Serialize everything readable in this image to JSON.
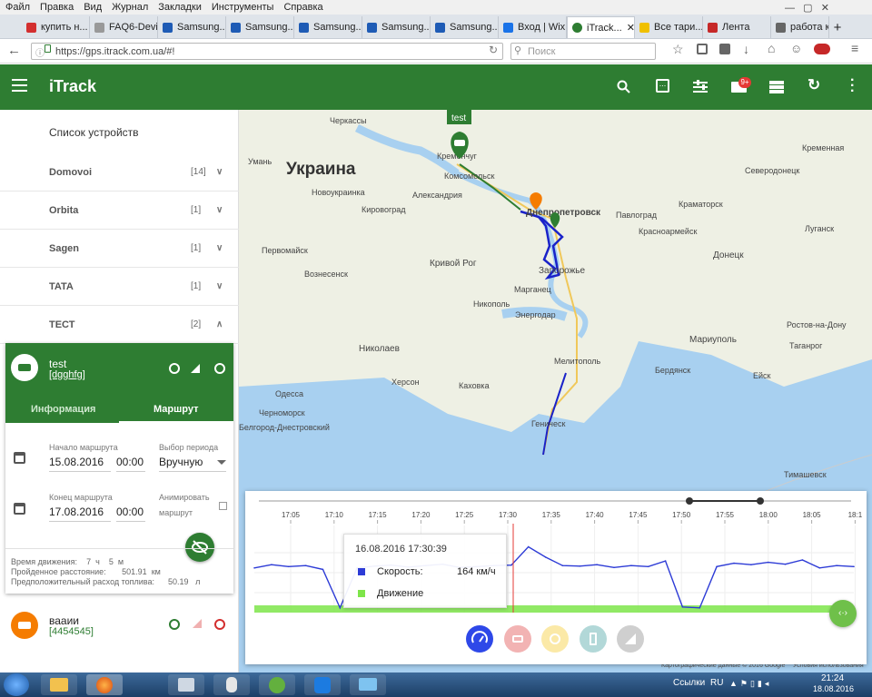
{
  "browser": {
    "menu": [
      "Файл",
      "Правка",
      "Вид",
      "Журнал",
      "Закладки",
      "Инструменты",
      "Справка"
    ],
    "tabs": [
      {
        "label": "купить н...",
        "color": "#d32f2f"
      },
      {
        "label": "FAQ6-Device...",
        "color": "#888"
      },
      {
        "label": "Samsung...",
        "color": "#1e5bb5"
      },
      {
        "label": "Samsung...",
        "color": "#1e5bb5"
      },
      {
        "label": "Samsung...",
        "color": "#1e5bb5"
      },
      {
        "label": "Samsung...",
        "color": "#1e5bb5"
      },
      {
        "label": "Samsung...",
        "color": "#1e5bb5"
      },
      {
        "label": "Вход | Wix",
        "color": "#1a73e8"
      },
      {
        "label": "iTrack...",
        "color": "#2e7d32"
      },
      {
        "label": "Все тари...",
        "color": "#f0c000"
      },
      {
        "label": "Лента",
        "color": "#c62828"
      },
      {
        "label": "работа к...",
        "color": "#555"
      }
    ],
    "url": "https://gps.itrack.com.ua/#!",
    "url_domain": "itrack.com.ua",
    "search_placeholder": "Поиск"
  },
  "app": {
    "title": "iTrack",
    "mail_badge": "9+",
    "accent": "#2e7d32"
  },
  "sidebar": {
    "header": "Список устройств",
    "groups": [
      {
        "name": "Domovoi",
        "count": "[14]"
      },
      {
        "name": "Orbita",
        "count": "[1]"
      },
      {
        "name": "Sagen",
        "count": "[1]"
      },
      {
        "name": "TATA",
        "count": "[1]"
      },
      {
        "name": "ТЕСТ",
        "count": "[2]"
      }
    ],
    "device": {
      "name": "test",
      "id": "[dgghfg]",
      "tab_info": "Информация",
      "tab_route": "Маршрут",
      "route_start_label": "Начало маршрута",
      "route_start_date": "15.08.2016",
      "route_start_time": "00:00",
      "period_label": "Выбор периода",
      "period_value": "Вручную",
      "route_end_label": "Конец маршрута",
      "route_end_date": "17.08.2016",
      "route_end_time": "00:00",
      "animate_label_1": "Анимировать",
      "animate_label_2": "маршрут",
      "stat_time_label": "Время движения:",
      "stat_time_h": "7",
      "stat_time_h_unit": "ч",
      "stat_time_m": "5",
      "stat_time_m_unit": "м",
      "stat_dist_label": "Пройденное расстояние:",
      "stat_dist_value": "501.91",
      "stat_dist_unit": "км",
      "stat_fuel_label": "Предположительный расход топлива:",
      "stat_fuel_value": "50.19",
      "stat_fuel_unit": "л"
    },
    "device2": {
      "name": "вааии",
      "id": "[4454545]"
    }
  },
  "map": {
    "country": "Украина",
    "marker_label": "test",
    "cities": [
      {
        "name": "Черкассы"
      },
      {
        "name": "Кременчуг"
      },
      {
        "name": "Комсомольск"
      },
      {
        "name": "Александрия"
      },
      {
        "name": "Днепропетровск"
      },
      {
        "name": "Кировоград"
      },
      {
        "name": "Кривой Рог"
      },
      {
        "name": "Запорожье"
      },
      {
        "name": "Никополь"
      },
      {
        "name": "Марганец"
      },
      {
        "name": "Энергодар"
      },
      {
        "name": "Николаев"
      },
      {
        "name": "Херсон"
      },
      {
        "name": "Мелитополь"
      },
      {
        "name": "Одесса"
      },
      {
        "name": "Черноморск"
      },
      {
        "name": "Белгород-Днестровский"
      },
      {
        "name": "Геническ"
      },
      {
        "name": "Павлоград"
      },
      {
        "name": "Краматорск"
      },
      {
        "name": "Донецк"
      },
      {
        "name": "Северодонецк"
      },
      {
        "name": "Луганск"
      },
      {
        "name": "Мариуполь"
      },
      {
        "name": "Бердянск"
      },
      {
        "name": "Ейск"
      },
      {
        "name": "Ростов-на-Дону"
      },
      {
        "name": "Таганрог"
      },
      {
        "name": "Тимашевск"
      },
      {
        "name": "Умань"
      },
      {
        "name": "Первомайск"
      },
      {
        "name": "Вознесенск"
      },
      {
        "name": "Новоукраинка"
      },
      {
        "name": "Каховка"
      },
      {
        "name": "Красноармейск"
      },
      {
        "name": "Кременная"
      }
    ],
    "attribution": "Картографические данные © 2016 Google",
    "terms": "Условия использования"
  },
  "chart_data": {
    "type": "line",
    "timeline_ticks": [
      "17:05",
      "17:10",
      "17:15",
      "17:20",
      "17:25",
      "17:30",
      "17:35",
      "17:40",
      "17:45",
      "17:50",
      "17:55",
      "18:00",
      "18:05",
      "18:1"
    ],
    "x_minutes": [
      0,
      2,
      4,
      6,
      8,
      10,
      12,
      14,
      16,
      18,
      20,
      22,
      24,
      26,
      28,
      30,
      32,
      34,
      36,
      38,
      40,
      42,
      44,
      46,
      48,
      50,
      52,
      54,
      56,
      58,
      60,
      62,
      64,
      66,
      68,
      70
    ],
    "series": [
      {
        "name": "Скорость",
        "color": "#2d3bd6",
        "values": [
          95,
          102,
          98,
          100,
          92,
          10,
          95,
          99,
          101,
          97,
          100,
          103,
          96,
          98,
          100,
          101,
          140,
          118,
          100,
          99,
          102,
          96,
          100,
          98,
          110,
          12,
          10,
          98,
          105,
          102,
          107,
          103,
          112,
          95,
          100,
          98
        ]
      },
      {
        "name": "Движение",
        "color": "#7ee54a",
        "values": [
          1,
          1,
          1,
          1,
          1,
          1,
          1,
          1,
          1,
          1,
          1,
          1,
          1,
          1,
          1,
          1,
          1,
          1,
          1,
          1,
          1,
          1,
          1,
          1,
          1,
          1,
          1,
          1,
          1,
          1,
          1,
          1,
          1,
          1,
          1,
          1
        ]
      }
    ],
    "tooltip": {
      "title": "16.08.2016 17:30:39",
      "speed_label": "Скорость:",
      "speed_value": "164 км/ч",
      "move_label": "Движение"
    },
    "ylim": [
      0,
      170
    ]
  },
  "taskbar": {
    "links": "Ссылки",
    "lang": "RU",
    "time": "21:24",
    "date": "18.08.2016"
  }
}
